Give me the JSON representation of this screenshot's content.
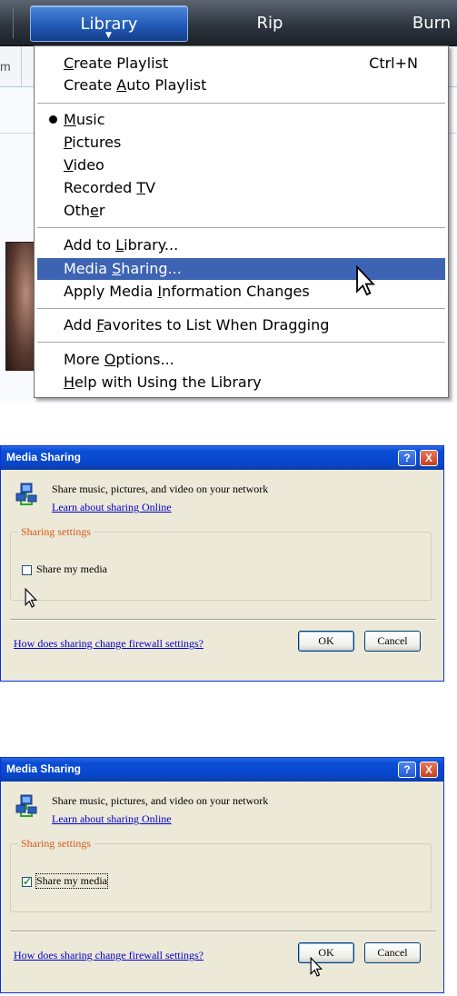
{
  "wmp": {
    "tabs": {
      "library": "Library",
      "rip": "Rip",
      "burn": "Burn"
    },
    "sub_fragment": "m"
  },
  "menu": {
    "create_playlist": {
      "pre": "",
      "ul": "C",
      "post": "reate Playlist",
      "shortcut": "Ctrl+N"
    },
    "create_auto": {
      "pre": "Create ",
      "ul": "A",
      "post": "uto Playlist"
    },
    "music": {
      "pre": "",
      "ul": "M",
      "post": "usic"
    },
    "pictures": {
      "pre": "",
      "ul": "P",
      "post": "ictures"
    },
    "video": {
      "pre": "",
      "ul": "V",
      "post": "ideo"
    },
    "recorded_tv": {
      "pre": "Recorded ",
      "ul": "T",
      "post": "V"
    },
    "other": {
      "pre": "Oth",
      "ul": "e",
      "post": "r"
    },
    "add_to_library": {
      "pre": "Add to ",
      "ul": "L",
      "post": "ibrary..."
    },
    "media_sharing": {
      "pre": "Media ",
      "ul": "S",
      "post": "haring..."
    },
    "apply_info": {
      "pre": "Apply Media ",
      "ul": "I",
      "post": "nformation Changes"
    },
    "add_favorites": {
      "pre": "Add ",
      "ul": "F",
      "post": "avorites to List When Dragging"
    },
    "more_options": {
      "pre": "More ",
      "ul": "O",
      "post": "ptions..."
    },
    "help": {
      "pre": "",
      "ul": "H",
      "post": "elp with Using the Library"
    }
  },
  "dialog": {
    "title": "Media Sharing",
    "help_btn": "?",
    "close_btn": "X",
    "intro": "Share music, pictures, and video on your network",
    "learn_link": "Learn about sharing Online",
    "group_label": "Sharing settings",
    "share_label": "Share my media",
    "firewall_link": "How does sharing change firewall settings?",
    "ok": "OK",
    "cancel": "Cancel"
  },
  "dialog1": {
    "share_checked": false
  },
  "dialog2": {
    "share_checked": true
  }
}
